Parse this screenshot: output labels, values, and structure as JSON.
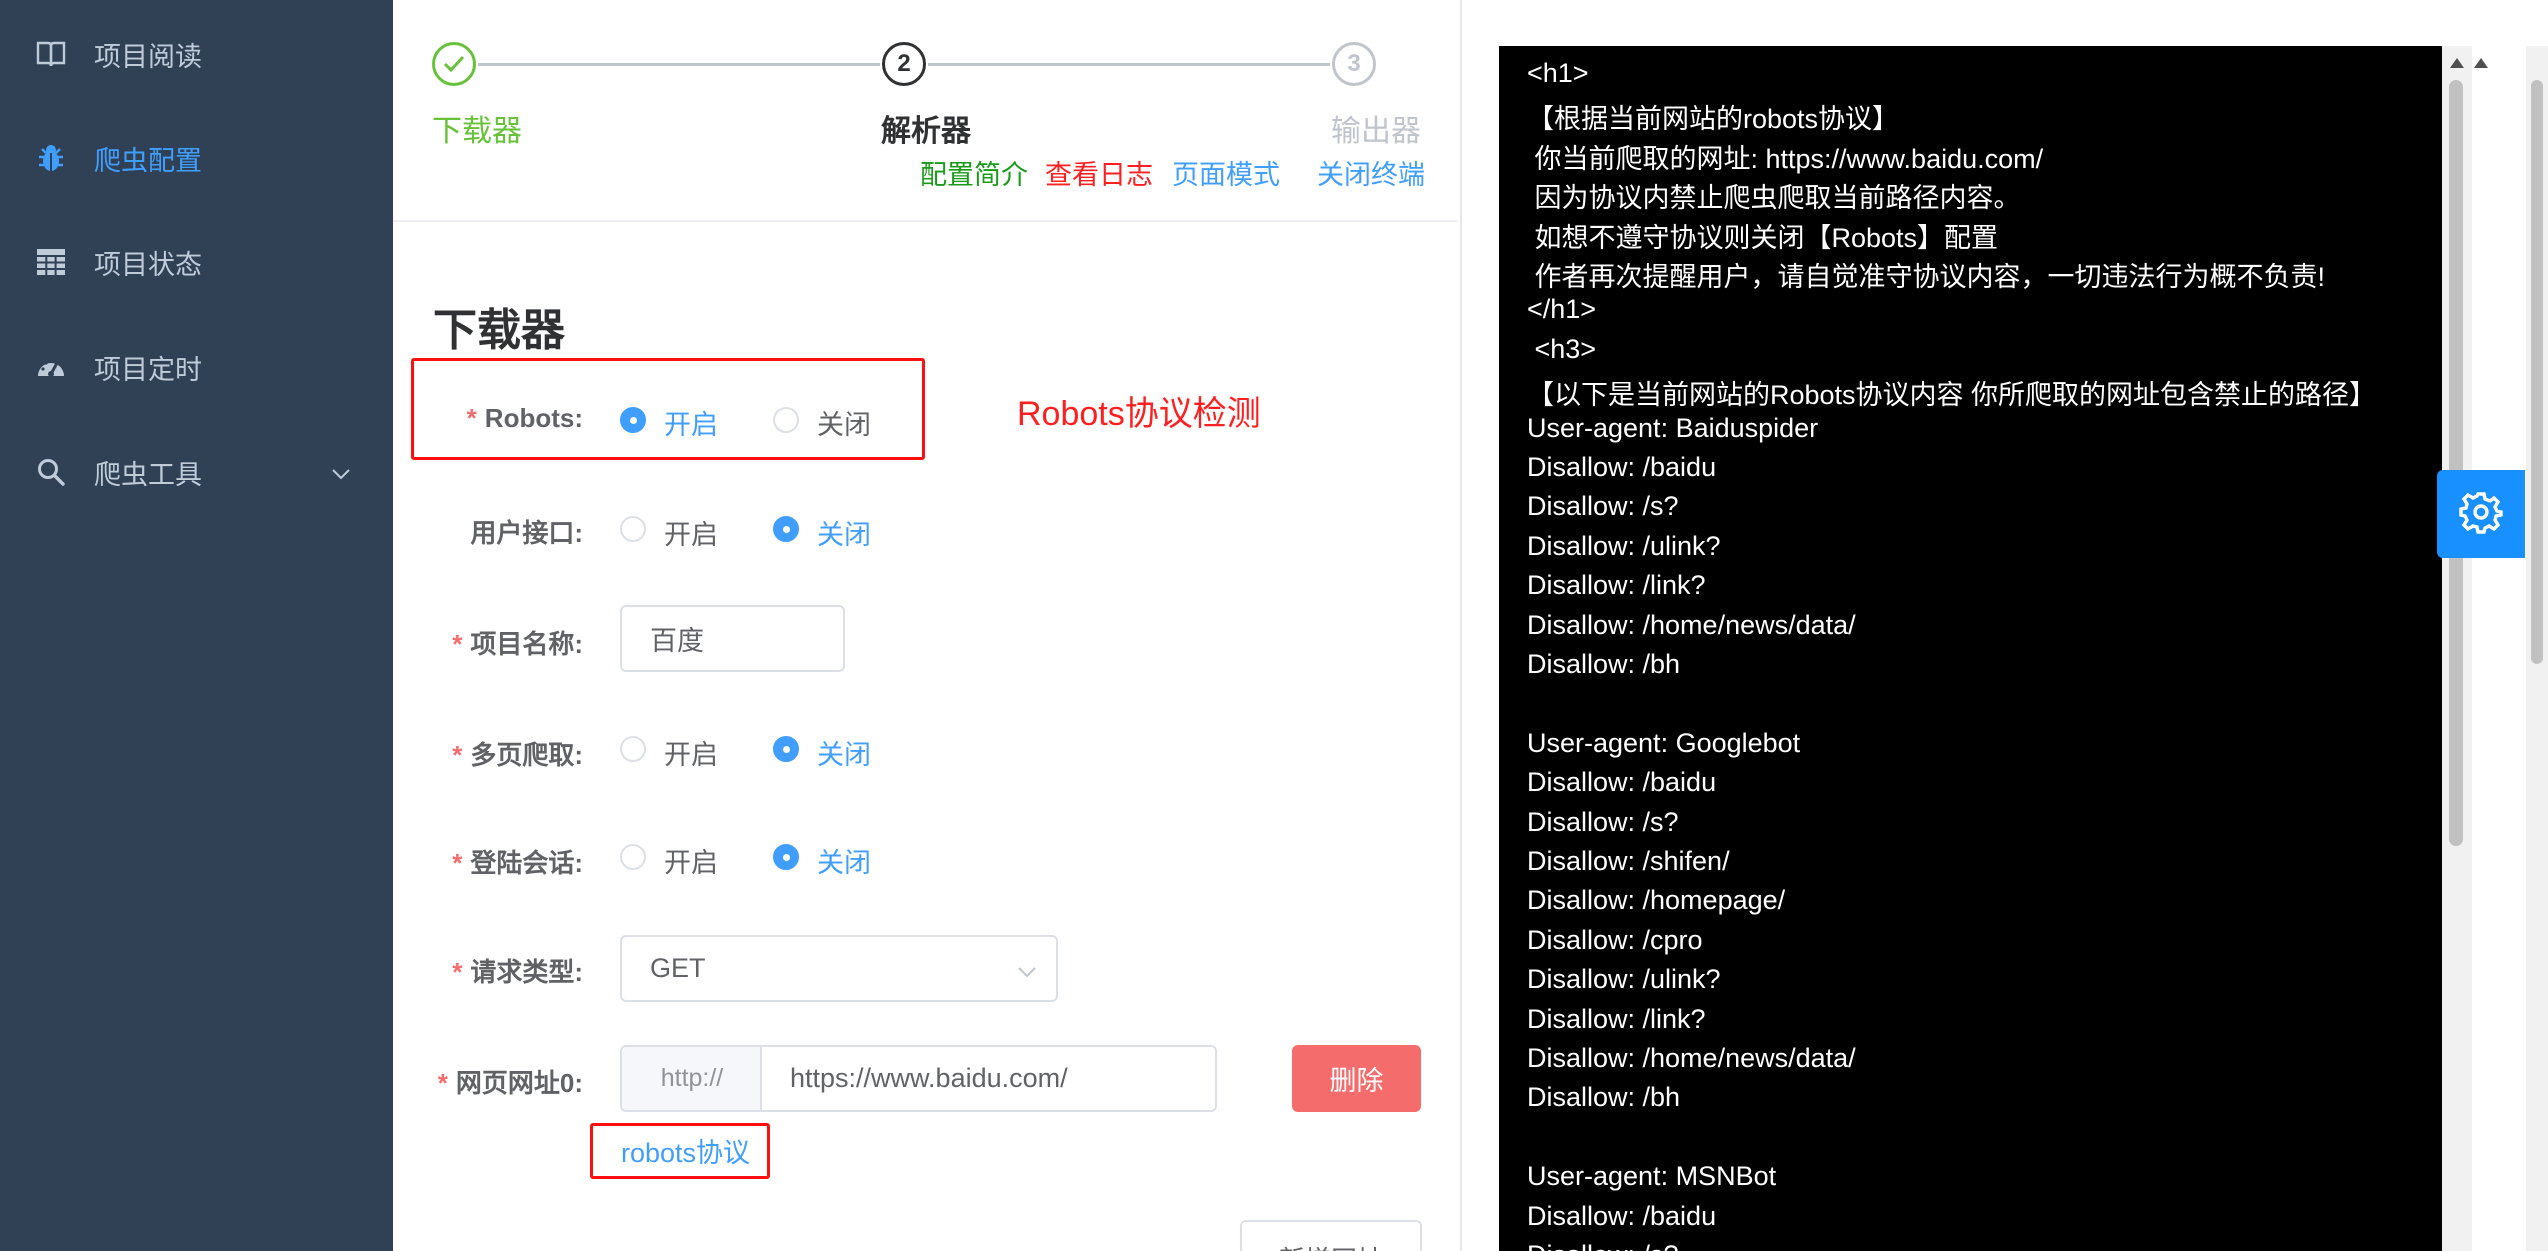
{
  "sidebar": {
    "items": [
      {
        "label": "项目阅读",
        "icon": "book-icon",
        "active": false
      },
      {
        "label": "爬虫配置",
        "icon": "bug-icon",
        "active": true
      },
      {
        "label": "项目状态",
        "icon": "grid-icon",
        "active": false
      },
      {
        "label": "项目定时",
        "icon": "dashboard-icon",
        "active": false
      },
      {
        "label": "爬虫工具",
        "icon": "search-icon",
        "active": false
      }
    ]
  },
  "steps": {
    "items": [
      {
        "title": "下载器",
        "status": "done"
      },
      {
        "title": "解析器",
        "number": "2",
        "status": "current"
      },
      {
        "title": "输出器",
        "number": "3",
        "status": "wait"
      }
    ],
    "links": [
      {
        "label": "配置简介",
        "color": "#1a9c1a"
      },
      {
        "label": "查看日志",
        "color": "#ff1f1f"
      },
      {
        "label": "页面模式",
        "color": "#409eff"
      },
      {
        "label": "关闭终端",
        "color": "#409eff"
      }
    ]
  },
  "form": {
    "title": "下载器",
    "robots": {
      "label": "Robots:",
      "options": [
        "开启",
        "关闭"
      ],
      "selected": "开启"
    },
    "user_interface": {
      "label": "用户接口:",
      "options": [
        "开启",
        "关闭"
      ],
      "selected": "关闭"
    },
    "project_name": {
      "label": "项目名称:",
      "value": "百度"
    },
    "multi_page": {
      "label": "多页爬取:",
      "options": [
        "开启",
        "关闭"
      ],
      "selected": "关闭"
    },
    "login_session": {
      "label": "登陆会话:",
      "options": [
        "开启",
        "关闭"
      ],
      "selected": "关闭"
    },
    "request_type": {
      "label": "请求类型:",
      "value": "GET"
    },
    "url": {
      "label": "网页网址0:",
      "prefix": "http://",
      "value": "https://www.baidu.com/"
    },
    "delete_label": "删除",
    "robots_link": "robots协议",
    "add_url_label": "新增网址"
  },
  "annotation": "Robots协议检测",
  "terminal": {
    "lines": [
      "<h1>",
      "【根据当前网站的robots协议】",
      " 你当前爬取的网址: https://www.baidu.com/",
      " 因为协议内禁止爬虫爬取当前路径内容。",
      " 如想不遵守协议则关闭【Robots】配置",
      " 作者再次提醒用户，请自觉准守协议内容，一切违法行为概不负责!",
      "</h1>",
      " <h3>",
      "【以下是当前网站的Robots协议内容 你所爬取的网址包含禁止的路径】",
      "User-agent: Baiduspider",
      "Disallow: /baidu",
      "Disallow: /s?",
      "Disallow: /ulink?",
      "Disallow: /link?",
      "Disallow: /home/news/data/",
      "Disallow: /bh",
      "",
      "User-agent: Googlebot",
      "Disallow: /baidu",
      "Disallow: /s?",
      "Disallow: /shifen/",
      "Disallow: /homepage/",
      "Disallow: /cpro",
      "Disallow: /ulink?",
      "Disallow: /link?",
      "Disallow: /home/news/data/",
      "Disallow: /bh",
      "",
      "User-agent: MSNBot",
      "Disallow: /baidu",
      "Disallow: /s?"
    ]
  },
  "colors": {
    "sidebar_bg": "#304156",
    "accent": "#409eff",
    "success": "#67c23a",
    "danger": "#f56c6c",
    "terminal_bg": "#000000"
  }
}
